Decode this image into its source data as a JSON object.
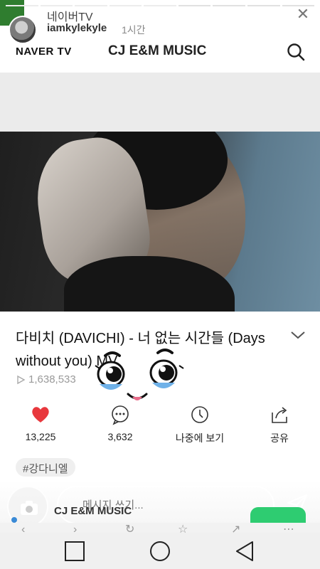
{
  "story": {
    "title": "네이버TV",
    "username": "iamkylekyle",
    "time": "1시간",
    "close_icon": "close-icon"
  },
  "header": {
    "logo": "NAVER TV",
    "channel": "CJ E&M MUSIC",
    "search_icon": "search-icon"
  },
  "video": {
    "title": "다비치 (DAVICHI) - 너 없는 시간들 (Days without you) MV",
    "views": "1,638,533"
  },
  "actions": [
    {
      "icon": "heart-icon",
      "label": "13,225"
    },
    {
      "icon": "comment-icon",
      "label": "3,632"
    },
    {
      "icon": "clock-icon",
      "label": "나중에 보기"
    },
    {
      "icon": "share-icon",
      "label": "공유"
    }
  ],
  "hashtag": "#강다니엘",
  "reply": {
    "placeholder": "메시지 쓰기...",
    "peek_channel": "CJ E&M MUSIC"
  },
  "colors": {
    "heart": "#e8383d",
    "accent_green": "#2ecc71"
  }
}
